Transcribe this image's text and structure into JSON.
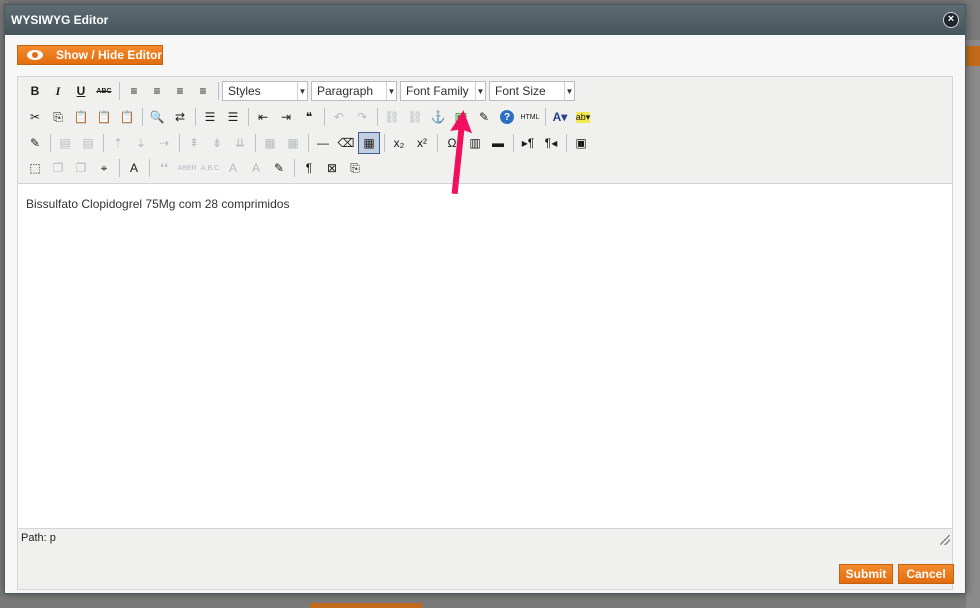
{
  "dialog": {
    "title": "WYSIWYG Editor",
    "close_label": "×"
  },
  "show_hide_label": "Show / Hide Editor",
  "toolbar": {
    "row1": [
      {
        "name": "bold-button",
        "glyph": "B",
        "style": "b"
      },
      {
        "name": "italic-button",
        "glyph": "I",
        "style": "i"
      },
      {
        "name": "underline-button",
        "glyph": "U",
        "style": "u"
      },
      {
        "name": "strikethrough-button",
        "glyph": "ABC",
        "style": "s"
      },
      {
        "sep": true
      },
      {
        "name": "align-left-button",
        "glyph": "≡"
      },
      {
        "name": "align-center-button",
        "glyph": "≡"
      },
      {
        "name": "align-right-button",
        "glyph": "≡"
      },
      {
        "name": "align-justify-button",
        "glyph": "≡"
      },
      {
        "sep": true
      }
    ],
    "selects": {
      "styles": "Styles",
      "paragraph": "Paragraph",
      "font_family": "Font Family",
      "font_size": "Font Size"
    },
    "row2": [
      {
        "name": "cut-button",
        "glyph": "✂"
      },
      {
        "name": "copy-button",
        "glyph": "⎘"
      },
      {
        "name": "paste-button",
        "glyph": "📋"
      },
      {
        "name": "paste-text-button",
        "glyph": "📋"
      },
      {
        "name": "paste-word-button",
        "glyph": "📋"
      },
      {
        "sep": true
      },
      {
        "name": "find-button",
        "glyph": "🔍"
      },
      {
        "name": "replace-button",
        "glyph": "⇄"
      },
      {
        "sep": true
      },
      {
        "name": "bullet-list-button",
        "glyph": "☰"
      },
      {
        "name": "numbered-list-button",
        "glyph": "☰"
      },
      {
        "sep": true
      },
      {
        "name": "outdent-button",
        "glyph": "⇤"
      },
      {
        "name": "indent-button",
        "glyph": "⇥"
      },
      {
        "name": "blockquote-button",
        "glyph": "❝"
      },
      {
        "sep": true
      },
      {
        "name": "undo-button",
        "glyph": "↶",
        "disabled": true
      },
      {
        "name": "redo-button",
        "glyph": "↷",
        "disabled": true
      },
      {
        "sep": true
      },
      {
        "name": "link-button",
        "glyph": "⛓",
        "disabled": true
      },
      {
        "name": "unlink-button",
        "glyph": "⛓",
        "disabled": true
      },
      {
        "name": "anchor-button",
        "glyph": "⚓"
      },
      {
        "name": "insert-image-button",
        "glyph": "▣"
      },
      {
        "name": "cleanup-button",
        "glyph": "✎"
      },
      {
        "name": "help-button",
        "glyph": "?"
      },
      {
        "name": "html-source-button",
        "glyph": "HTML"
      },
      {
        "sep": true
      },
      {
        "name": "text-color-button",
        "glyph": "A▾"
      },
      {
        "name": "highlight-color-button",
        "glyph": "ab▾"
      }
    ],
    "row3": [
      {
        "name": "edit-button",
        "glyph": "✎"
      },
      {
        "sep": true
      },
      {
        "name": "table-row-props-button",
        "glyph": "▤",
        "disabled": true
      },
      {
        "name": "table-cell-props-button",
        "glyph": "▤",
        "disabled": true
      },
      {
        "sep": true
      },
      {
        "name": "insert-row-before-button",
        "glyph": "⇡",
        "disabled": true
      },
      {
        "name": "insert-row-after-button",
        "glyph": "⇣",
        "disabled": true
      },
      {
        "name": "delete-row-button",
        "glyph": "⇢",
        "disabled": true
      },
      {
        "sep": true
      },
      {
        "name": "insert-col-before-button",
        "glyph": "⇞",
        "disabled": true
      },
      {
        "name": "insert-col-after-button",
        "glyph": "⇟",
        "disabled": true
      },
      {
        "name": "delete-col-button",
        "glyph": "⇊",
        "disabled": true
      },
      {
        "sep": true
      },
      {
        "name": "split-cells-button",
        "glyph": "▦",
        "disabled": true
      },
      {
        "name": "merge-cells-button",
        "glyph": "▦",
        "disabled": true
      },
      {
        "sep": true
      },
      {
        "name": "horizontal-rule-button",
        "glyph": "—"
      },
      {
        "name": "remove-format-button",
        "glyph": "⌫"
      },
      {
        "name": "visual-aid-button",
        "glyph": "▦",
        "active": true
      },
      {
        "sep": true
      },
      {
        "name": "subscript-button",
        "glyph": "x₂"
      },
      {
        "name": "superscript-button",
        "glyph": "x²"
      },
      {
        "sep": true
      },
      {
        "name": "special-char-button",
        "glyph": "Ω"
      },
      {
        "name": "insert-media-button",
        "glyph": "▥"
      },
      {
        "name": "advanced-hr-button",
        "glyph": "▬"
      },
      {
        "sep": true
      },
      {
        "name": "ltr-button",
        "glyph": "▸¶"
      },
      {
        "name": "rtl-button",
        "glyph": "¶◂"
      },
      {
        "sep": true
      },
      {
        "name": "fullscreen-button",
        "glyph": "▣"
      }
    ],
    "row4": [
      {
        "name": "insert-layer-button",
        "glyph": "⬚"
      },
      {
        "name": "move-forward-button",
        "glyph": "❐",
        "disabled": true
      },
      {
        "name": "move-backward-button",
        "glyph": "❐",
        "disabled": true
      },
      {
        "name": "absolute-button",
        "glyph": "⌖"
      },
      {
        "sep": true
      },
      {
        "name": "styleprops-button",
        "glyph": "A"
      },
      {
        "sep": true
      },
      {
        "name": "cite-button",
        "glyph": "❛❛",
        "disabled": true
      },
      {
        "name": "abbr-button",
        "glyph": "ABBR",
        "disabled": true
      },
      {
        "name": "acronym-button",
        "glyph": "A.B.C",
        "disabled": true
      },
      {
        "name": "del-button",
        "glyph": "A",
        "disabled": true
      },
      {
        "name": "ins-button",
        "glyph": "A",
        "disabled": true
      },
      {
        "name": "attribs-button",
        "glyph": "✎"
      },
      {
        "sep": true
      },
      {
        "name": "visualchars-button",
        "glyph": "¶"
      },
      {
        "name": "nonbreaking-button",
        "glyph": "⊠"
      },
      {
        "name": "pagebreak-button",
        "glyph": "⎘"
      }
    ]
  },
  "editor_content": "Bissulfato Clopidogrel 75Mg com 28 comprimidos",
  "status_path": "Path: p",
  "buttons": {
    "submit": "Submit",
    "cancel": "Cancel"
  },
  "colors": {
    "accent_orange": "#e36d10",
    "titlebar": "#4f5e64",
    "pointer_arrow": "#f0105f"
  }
}
